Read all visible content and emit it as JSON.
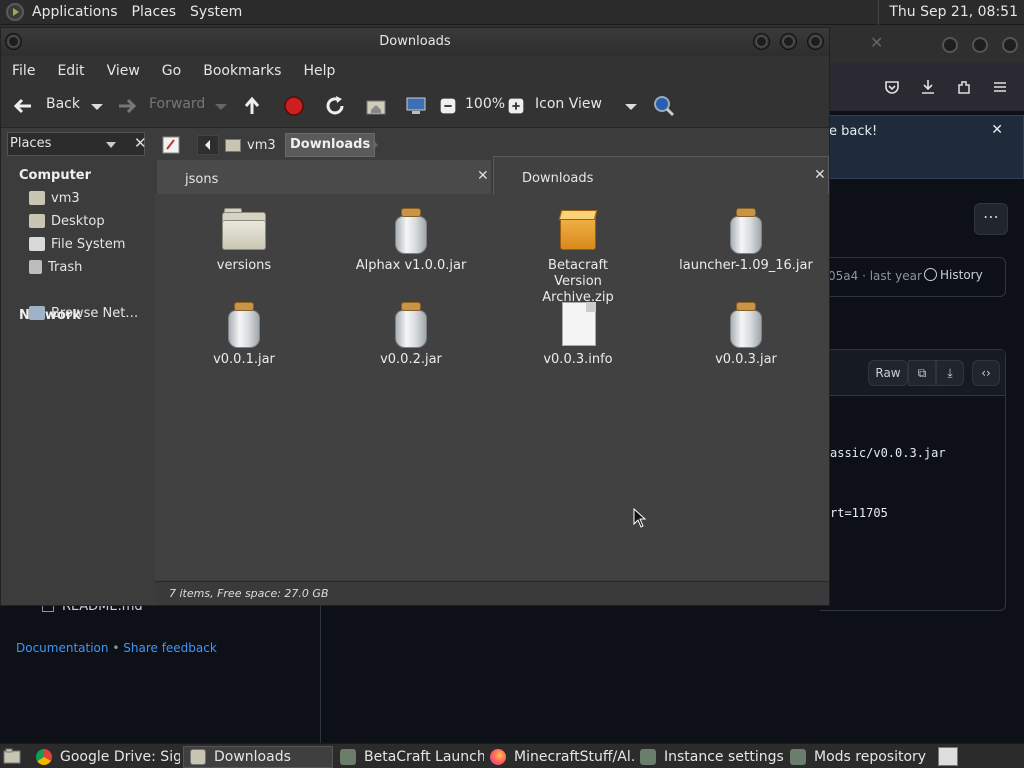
{
  "top_panel": {
    "menus": [
      "Applications",
      "Places",
      "System"
    ],
    "clock": "Thu Sep 21, 08:51"
  },
  "background_browser": {
    "banner_text": "e back!",
    "commit_hash": "05a4 · last year",
    "history_label": "History",
    "raw_label": "Raw",
    "code_lines": [
      "assic/v0.0.3.jar",
      "rt=11705"
    ],
    "readme_label": "README.md",
    "footer_links": [
      "Documentation",
      "Share feedback"
    ],
    "footer_separator": "•"
  },
  "file_manager": {
    "title": "Downloads",
    "menu": [
      "File",
      "Edit",
      "View",
      "Go",
      "Bookmarks",
      "Help"
    ],
    "toolbar": {
      "back": "Back",
      "forward": "Forward",
      "zoom": "100%",
      "view_mode": "Icon View"
    },
    "sidebar": {
      "header": "Places",
      "sections": [
        {
          "title": "Computer",
          "items": [
            "vm3",
            "Desktop",
            "File System",
            "Trash"
          ]
        },
        {
          "title": "Network",
          "items": [
            "Browse Net…"
          ]
        }
      ]
    },
    "path": [
      "vm3",
      "Downloads"
    ],
    "tabs": [
      {
        "label": "jsons",
        "active": false
      },
      {
        "label": "Downloads",
        "active": true
      }
    ],
    "items": [
      {
        "name": "versions",
        "type": "folder"
      },
      {
        "name": "Alphax v1.0.0.jar",
        "type": "jar"
      },
      {
        "name": "Betacraft Version Archive.zip",
        "type": "zip"
      },
      {
        "name": "launcher-1.09_16.jar",
        "type": "jar"
      },
      {
        "name": "v0.0.1.jar",
        "type": "jar"
      },
      {
        "name": "v0.0.2.jar",
        "type": "jar"
      },
      {
        "name": "v0.0.3.info",
        "type": "document"
      },
      {
        "name": "v0.0.3.jar",
        "type": "jar"
      }
    ],
    "status": "7 items, Free space: 27.0 GB"
  },
  "taskbar": {
    "tasks": [
      {
        "label": "Google Drive: Sig…",
        "icon": "chrome-icon"
      },
      {
        "label": "Downloads",
        "icon": "folder-icon",
        "active": true
      },
      {
        "label": "BetaCraft Launch…",
        "icon": "launcher-icon"
      },
      {
        "label": "MinecraftStuff/Al…",
        "icon": "firefox-icon"
      },
      {
        "label": "Instance settings",
        "icon": "launcher-icon"
      },
      {
        "label": "Mods repository",
        "icon": "launcher-icon"
      }
    ]
  },
  "colors": {
    "panel": "#2b2b2b",
    "window_bg": "#3c3c3c",
    "content_bg": "#414141",
    "link": "#4493f8",
    "stop_red": "#cc1f1f"
  }
}
